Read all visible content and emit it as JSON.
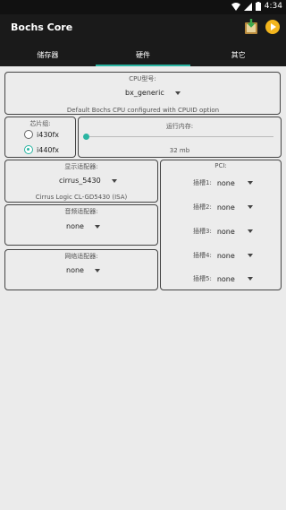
{
  "statusbar": {
    "time": "4:34"
  },
  "app": {
    "title": "Bochs Core"
  },
  "tabs": [
    {
      "label": "储存器",
      "active": false
    },
    {
      "label": "硬件",
      "active": true
    },
    {
      "label": "其它",
      "active": false
    }
  ],
  "cpu": {
    "label": "CPU型号:",
    "value": "bx_generic",
    "description": "Default Bochs CPU configured with CPUID option"
  },
  "chipset": {
    "label": "芯片组:",
    "options": [
      {
        "label": "i430fx",
        "checked": false
      },
      {
        "label": "i440fx",
        "checked": true
      }
    ]
  },
  "memory": {
    "label": "运行内存:",
    "value_text": "32 mb",
    "slider_fraction": 0.0
  },
  "display": {
    "label": "显示适配器:",
    "value": "cirrus_5430",
    "description": "Cirrus Logic CL-GD5430 (ISA)"
  },
  "sound": {
    "label": "音频适配器:",
    "value": "none"
  },
  "network": {
    "label": "网络适配器:",
    "value": "none"
  },
  "pci": {
    "label": "PCI:",
    "slots": [
      {
        "label": "插槽1:",
        "value": "none"
      },
      {
        "label": "插槽2:",
        "value": "none"
      },
      {
        "label": "插槽3:",
        "value": "none"
      },
      {
        "label": "插槽4:",
        "value": "none"
      },
      {
        "label": "插槽5:",
        "value": "none"
      }
    ]
  },
  "colors": {
    "accent": "#2ab5a2",
    "bar": "#1a1a1a",
    "background": "#ebebeb"
  },
  "icons": [
    "wifi-icon",
    "signal-icon",
    "battery-icon",
    "save-icon",
    "play-icon"
  ]
}
